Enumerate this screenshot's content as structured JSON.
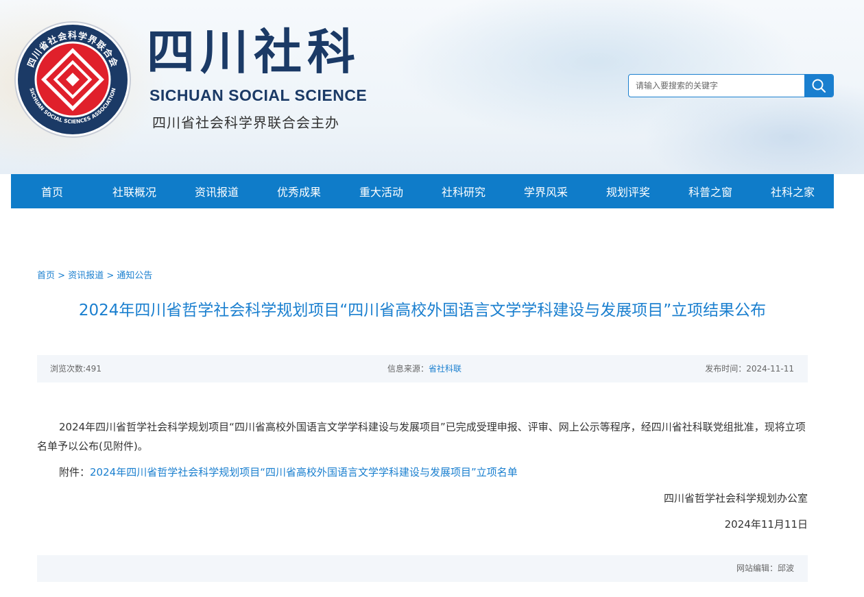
{
  "header": {
    "logo": {
      "ring_text": "四川省社会科学界联合会",
      "ring_text_en": "SICHUAN SOCIAL SCIENCES ASSOCIATION"
    },
    "brand_cn": "四川社科",
    "brand_en": "SICHUAN SOCIAL SCIENCE",
    "brand_sub": "四川省社会科学界联合会主办",
    "search": {
      "placeholder": "请输入要搜索的关键字",
      "icon": "search-icon"
    }
  },
  "nav": {
    "items": [
      "首页",
      "社联概况",
      "资讯报道",
      "优秀成果",
      "重大活动",
      "社科研究",
      "学界风采",
      "规划评奖",
      "科普之窗",
      "社科之家"
    ]
  },
  "breadcrumb": {
    "items": [
      "首页",
      "资讯报道",
      "通知公告"
    ],
    "separator": ">"
  },
  "article": {
    "title": "2024年四川省哲学社会科学规划项目“四川省高校外国语言文学学科建设与发展项目”立项结果公布",
    "meta": {
      "views_label": "浏览次数:",
      "views": "491",
      "source_label": "信息来源：",
      "source": "省社科联",
      "date_label": "发布时间：",
      "date": "2024-11-11"
    },
    "paragraph": "2024年四川省哲学社会科学规划项目“四川省高校外国语言文学学科建设与发展项目”已完成受理申报、评审、网上公示等程序，经四川省社科联党组批准，现将立项名单予以公布(见附件)。",
    "attachment_label": "附件：",
    "attachment_link": "2024年四川省哲学社会科学规划项目“四川省高校外国语言文学学科建设与发展项目”立项名单",
    "signature": "四川省哲学社会科学规划办公室",
    "sign_date": "2024年11月11日"
  },
  "footer": {
    "editor_label": "网站编辑：",
    "editor": "邱波"
  },
  "colors": {
    "nav_bg": "#0f7cc9",
    "link": "#1a7fcf",
    "brand": "#1b3a66",
    "logo_red": "#e0202b",
    "logo_navy": "#1b3a66"
  }
}
